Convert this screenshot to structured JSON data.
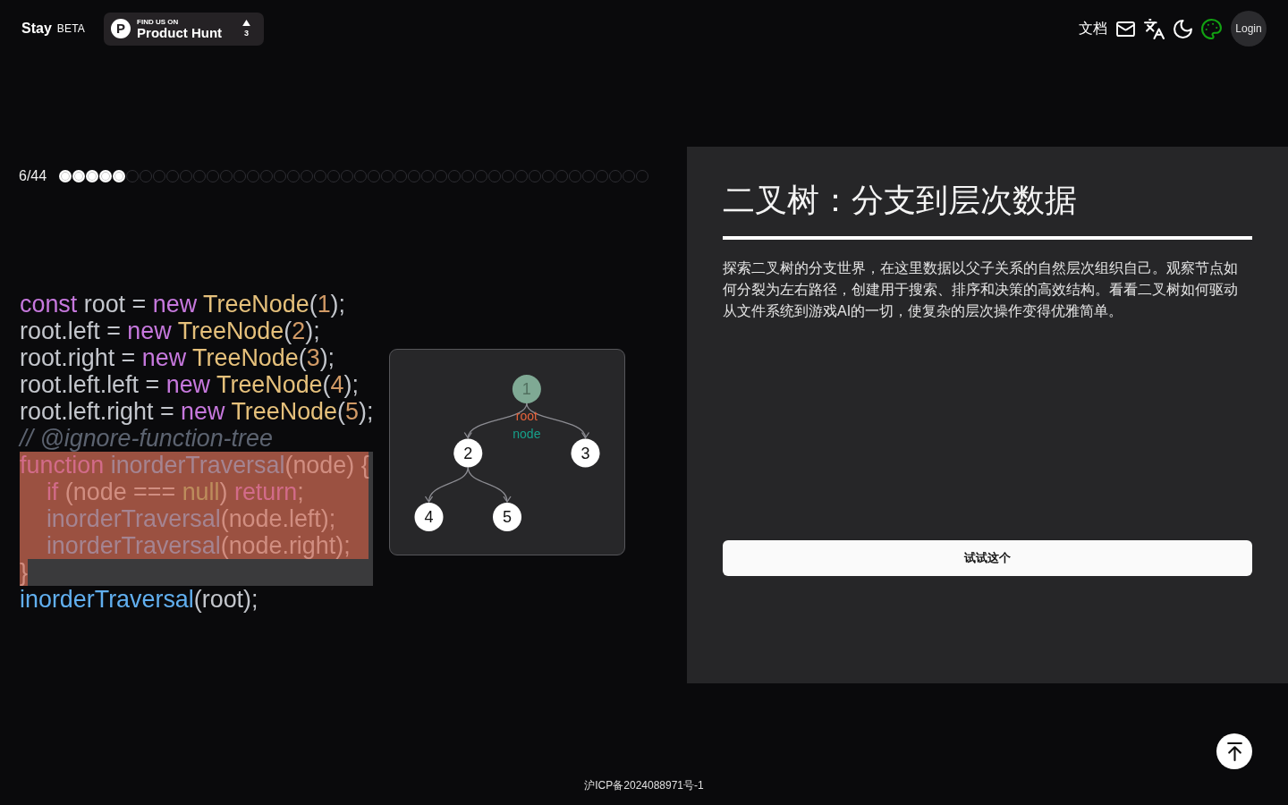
{
  "header": {
    "brand": "Stay",
    "tag": "BETA",
    "badge": {
      "logo": "P",
      "kicker": "FIND US ON",
      "title": "Product Hunt",
      "votes": "3"
    },
    "nav": {
      "docs": "文档",
      "login": "Login"
    }
  },
  "progress": {
    "label": "6/44",
    "steps": [
      {
        "filled": true
      },
      {
        "filled": true
      },
      {
        "filled": true
      },
      {
        "filled": true
      },
      {
        "filled": true
      },
      {
        "filled": false
      },
      {
        "filled": false
      },
      {
        "filled": false
      },
      {
        "filled": false
      },
      {
        "filled": false
      },
      {
        "filled": false
      },
      {
        "filled": false
      },
      {
        "filled": false
      },
      {
        "filled": false
      },
      {
        "filled": false
      },
      {
        "filled": false
      },
      {
        "filled": false
      },
      {
        "filled": false
      },
      {
        "filled": false
      },
      {
        "filled": false
      },
      {
        "filled": false
      },
      {
        "filled": false
      },
      {
        "filled": false
      },
      {
        "filled": false
      },
      {
        "filled": false
      },
      {
        "filled": false
      },
      {
        "filled": false
      },
      {
        "filled": false
      },
      {
        "filled": false
      },
      {
        "filled": false
      },
      {
        "filled": false
      },
      {
        "filled": false
      },
      {
        "filled": false
      },
      {
        "filled": false
      },
      {
        "filled": false
      },
      {
        "filled": false
      },
      {
        "filled": false
      },
      {
        "filled": false
      },
      {
        "filled": false
      },
      {
        "filled": false
      },
      {
        "filled": false
      },
      {
        "filled": false
      },
      {
        "filled": false
      },
      {
        "filled": false
      }
    ]
  },
  "code": {
    "lines": [
      {
        "highlighted": false,
        "marked": false,
        "in_block": false,
        "tokens": [
          {
            "text": "const",
            "kind": "keyword"
          },
          {
            "text": " root = ",
            "kind": "plain"
          },
          {
            "text": "new",
            "kind": "keyword"
          },
          {
            "text": " TreeNode",
            "kind": "class"
          },
          {
            "text": "(",
            "kind": "plain"
          },
          {
            "text": "1",
            "kind": "number"
          },
          {
            "text": ");",
            "kind": "plain"
          }
        ]
      },
      {
        "highlighted": false,
        "marked": false,
        "in_block": false,
        "tokens": [
          {
            "text": "root.left = ",
            "kind": "plain"
          },
          {
            "text": "new",
            "kind": "keyword"
          },
          {
            "text": " TreeNode",
            "kind": "class"
          },
          {
            "text": "(",
            "kind": "plain"
          },
          {
            "text": "2",
            "kind": "number"
          },
          {
            "text": ");",
            "kind": "plain"
          }
        ]
      },
      {
        "highlighted": false,
        "marked": false,
        "in_block": false,
        "tokens": [
          {
            "text": "root.right = ",
            "kind": "plain"
          },
          {
            "text": "new",
            "kind": "keyword"
          },
          {
            "text": " TreeNode",
            "kind": "class"
          },
          {
            "text": "(",
            "kind": "plain"
          },
          {
            "text": "3",
            "kind": "number"
          },
          {
            "text": ");",
            "kind": "plain"
          }
        ]
      },
      {
        "highlighted": false,
        "marked": false,
        "in_block": false,
        "tokens": [
          {
            "text": "root.left.left = ",
            "kind": "plain"
          },
          {
            "text": "new",
            "kind": "keyword"
          },
          {
            "text": " TreeNode",
            "kind": "class"
          },
          {
            "text": "(",
            "kind": "plain"
          },
          {
            "text": "4",
            "kind": "number"
          },
          {
            "text": ");",
            "kind": "plain"
          }
        ]
      },
      {
        "highlighted": false,
        "marked": false,
        "in_block": false,
        "tokens": [
          {
            "text": "root.left.right = ",
            "kind": "plain"
          },
          {
            "text": "new",
            "kind": "keyword"
          },
          {
            "text": " TreeNode",
            "kind": "class"
          },
          {
            "text": "(",
            "kind": "plain"
          },
          {
            "text": "5",
            "kind": "number"
          },
          {
            "text": ");",
            "kind": "plain"
          }
        ]
      },
      {
        "highlighted": false,
        "marked": false,
        "in_block": false,
        "tokens": [
          {
            "text": "// @ignore-function-tree",
            "kind": "comment"
          }
        ]
      },
      {
        "highlighted": true,
        "marked": false,
        "in_block": true,
        "tokens": [
          {
            "text": "function",
            "kind": "keyword"
          },
          {
            "text": " inorderTraversal",
            "kind": "function"
          },
          {
            "text": "(node) {",
            "kind": "plain"
          }
        ]
      },
      {
        "highlighted": true,
        "marked": false,
        "in_block": true,
        "tokens": [
          {
            "text": "    if",
            "kind": "keyword"
          },
          {
            "text": " (node === ",
            "kind": "plain"
          },
          {
            "text": "null",
            "kind": "literal"
          },
          {
            "text": ") ",
            "kind": "plain"
          },
          {
            "text": "return",
            "kind": "keyword"
          },
          {
            "text": ";",
            "kind": "plain"
          }
        ]
      },
      {
        "highlighted": true,
        "marked": false,
        "in_block": true,
        "tokens": [
          {
            "text": "    inorderTraversal",
            "kind": "function"
          },
          {
            "text": "(node.left);",
            "kind": "plain"
          }
        ]
      },
      {
        "highlighted": true,
        "marked": false,
        "in_block": true,
        "tokens": [
          {
            "text": "    inorderTraversal",
            "kind": "function"
          },
          {
            "text": "(node.right);",
            "kind": "plain"
          }
        ]
      },
      {
        "highlighted": false,
        "marked": true,
        "in_block": true,
        "tokens": [
          {
            "text": "}",
            "kind": "plain"
          }
        ]
      },
      {
        "highlighted": false,
        "marked": false,
        "in_block": false,
        "tokens": [
          {
            "text": "inorderTraversal",
            "kind": "function"
          },
          {
            "text": "(root);",
            "kind": "plain"
          }
        ]
      }
    ]
  },
  "tree": {
    "root": {
      "value": "1",
      "selected": true,
      "pointers": [
        {
          "text": "root",
          "color": "#e8643c"
        },
        {
          "text": "node",
          "color": "#16a08a"
        }
      ],
      "children": [
        {
          "value": "2",
          "selected": false,
          "children": [
            {
              "value": "4",
              "selected": false
            },
            {
              "value": "5",
              "selected": false
            }
          ]
        },
        {
          "value": "3",
          "selected": false
        }
      ]
    }
  },
  "lesson": {
    "title": "二叉树：分支到层次数据",
    "body": "探索二叉树的分支世界，在这里数据以父子关系的自然层次组织自己。观察节点如何分裂为左右路径，创建用于搜索、排序和决策的高效结构。看看二叉树如何驱动从文件系统到游戏AI的一切，使复杂的层次操作变得优雅简单。",
    "button": "试试这个"
  },
  "footer": {
    "license": "沪ICP备2024088971号-1"
  }
}
